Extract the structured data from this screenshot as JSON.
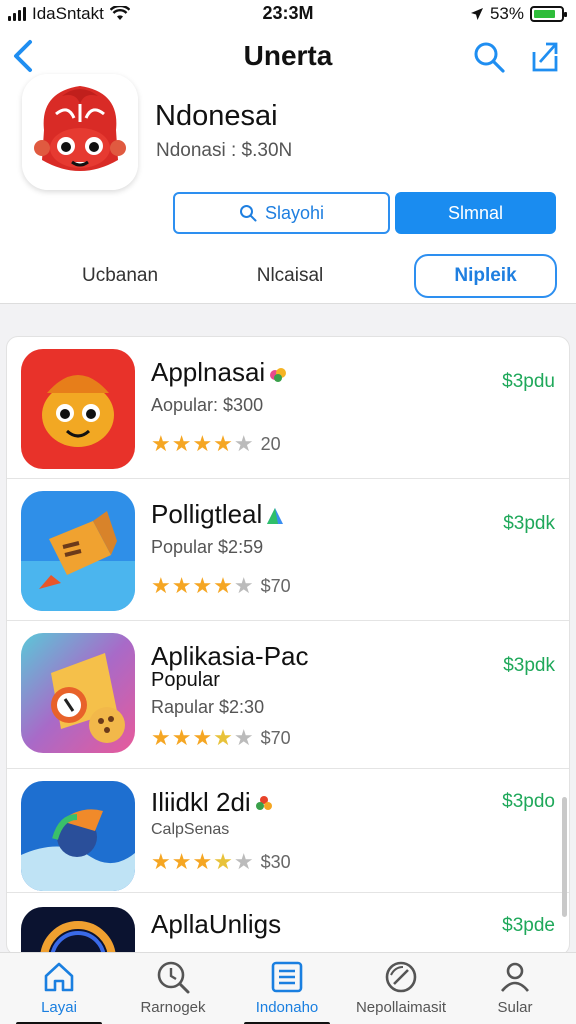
{
  "status_bar": {
    "carrier": "IdaSntakt",
    "time": "23:3M",
    "battery": "53%",
    "battery_level": 0.8
  },
  "nav": {
    "back_icon": "chevron-left-icon",
    "title": "Unerta",
    "search_icon": "search-icon",
    "share_icon": "share-icon"
  },
  "hero": {
    "name": "Ndonesai",
    "price_line": "Ndonasi : $.30N",
    "search_button": "Slayohi",
    "primary_button": "Slmnal"
  },
  "tabs": [
    {
      "label": "Ucbanan"
    },
    {
      "label": "Nlcaisal"
    },
    {
      "label": "Nipleik"
    }
  ],
  "apps": [
    {
      "name": "Applnasai",
      "sub": "Aopular: $300",
      "stars": 4,
      "count": "20",
      "price": "$3pdu",
      "color": "#e8322a"
    },
    {
      "name": "Polligtleal",
      "sub": "Popular $2:59",
      "stars": 4,
      "count": "$70",
      "price": "$3pdk",
      "color": "#2f8fe8"
    },
    {
      "name": "Aplikasia-Pac",
      "sub_bold": "Popular",
      "sub": "Rapular $2:30",
      "stars": 3,
      "count": "$70",
      "price": "$3pdk",
      "color": "#6cc0a8"
    },
    {
      "name": "Iliidkl 2di",
      "sub": "CalpSenas",
      "stars": 3,
      "count": "$30",
      "price": "$3pdo",
      "color": "#1e6fd0"
    },
    {
      "name": "ApllaUnligs",
      "sub": "",
      "stars": 0,
      "count": "",
      "price": "$3pde",
      "color": "#0b1330"
    }
  ],
  "tabbar": [
    {
      "label": "Layai",
      "icon": "home-icon"
    },
    {
      "label": "Rarnogek",
      "icon": "clock-search-icon"
    },
    {
      "label": "Indonaho",
      "icon": "list-icon"
    },
    {
      "label": "Nepollaimasit",
      "icon": "gauge-icon"
    },
    {
      "label": "Sular",
      "icon": "user-icon"
    }
  ]
}
